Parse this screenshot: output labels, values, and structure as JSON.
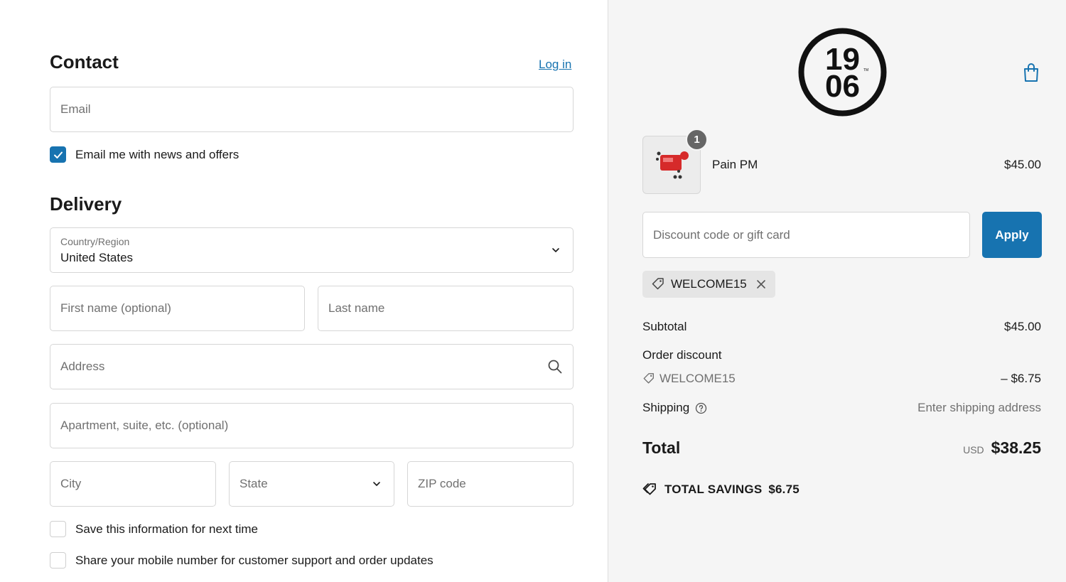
{
  "contact": {
    "heading": "Contact",
    "login_link": "Log in",
    "email_placeholder": "Email",
    "newsletter_label": "Email me with news and offers",
    "newsletter_checked": true
  },
  "delivery": {
    "heading": "Delivery",
    "country_label": "Country/Region",
    "country_value": "United States",
    "first_name_placeholder": "First name (optional)",
    "last_name_placeholder": "Last name",
    "address_placeholder": "Address",
    "apartment_placeholder": "Apartment, suite, etc. (optional)",
    "city_placeholder": "City",
    "state_placeholder": "State",
    "zip_placeholder": "ZIP code",
    "save_info_label": "Save this information for next time",
    "share_mobile_label": "Share your mobile number for customer support and order updates"
  },
  "summary": {
    "logo_text_top": "19",
    "logo_text_bottom": "06",
    "logo_tm": "TM",
    "product": {
      "name": "Pain PM",
      "price": "$45.00",
      "quantity": "1"
    },
    "discount_placeholder": "Discount code or gift card",
    "apply_label": "Apply",
    "applied_code": "WELCOME15",
    "subtotal_label": "Subtotal",
    "subtotal_value": "$45.00",
    "order_discount_label": "Order discount",
    "order_discount_code": "WELCOME15",
    "order_discount_value": "– $6.75",
    "shipping_label": "Shipping",
    "shipping_value": "Enter shipping address",
    "total_label": "Total",
    "total_currency": "USD",
    "total_value": "$38.25",
    "savings_label": "TOTAL SAVINGS",
    "savings_value": "$6.75"
  },
  "colors": {
    "accent": "#1773b0",
    "summary_bg": "#f5f5f5",
    "border": "#d6d6d6"
  }
}
